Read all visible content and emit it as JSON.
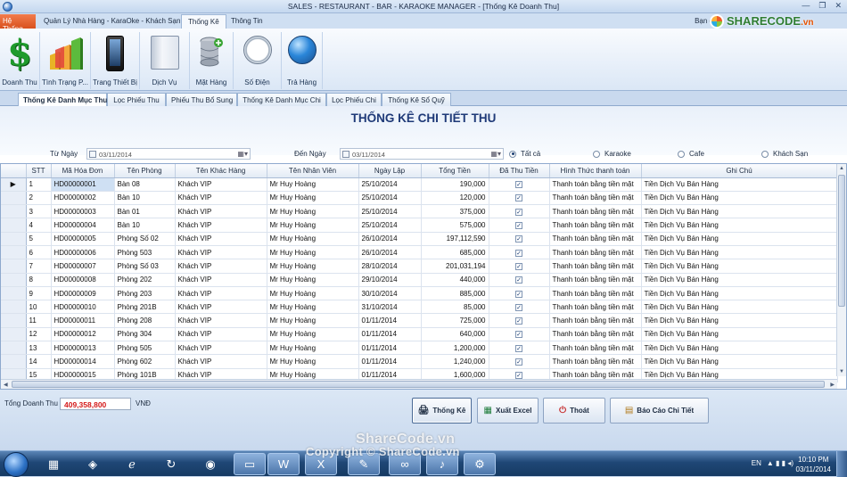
{
  "window": {
    "title": "SALES - RESTAURANT - BAR - KARAOKE MANAGER - [Thống Kê Doanh Thu]"
  },
  "ribbon_tabs": [
    "Hệ Thống",
    "Quản Lý Nhà Hàng - KaraOke - Khách Sạn",
    "Thống Kê",
    "Thông Tin"
  ],
  "user_label": "Bạn đ",
  "logo": {
    "text": "SHARECODE",
    "suffix": ".vn"
  },
  "ribbon_buttons": [
    {
      "label": "Doanh Thu",
      "icon": "dollar-icon"
    },
    {
      "label": "Tình Trạng P...",
      "icon": "bar-chart-icon"
    },
    {
      "label": "Trang Thiết Bị",
      "icon": "phone-icon"
    },
    {
      "label": "Dịch Vụ",
      "icon": "book-icon"
    },
    {
      "label": "Mặt Hàng",
      "icon": "database-add-icon"
    },
    {
      "label": "Số Điện",
      "icon": "clock-icon"
    },
    {
      "label": "Trả Hàng",
      "icon": "globe-icon"
    }
  ],
  "sub_tabs": [
    "Thống Kê Danh Mục Thu",
    "Lọc Phiếu Thu",
    "Phiếu Thu Bổ Sung",
    "Thống Kê Danh Mục Chi",
    "Lọc Phiếu Chi",
    "Thống Kê Sổ Quỹ"
  ],
  "form": {
    "heading": "THỐNG KÊ CHI TIẾT THU",
    "from_label": "Từ Ngày",
    "from_value": "03/11/2014",
    "to_label": "Đến Ngày",
    "to_value": "03/11/2014",
    "radios": [
      {
        "label": "Tất cả",
        "checked": true
      },
      {
        "label": "Karaoke",
        "checked": false
      },
      {
        "label": "Cafe",
        "checked": false
      },
      {
        "label": "Khách Sạn",
        "checked": false
      }
    ]
  },
  "table": {
    "columns": [
      "STT",
      "Mã Hóa Đơn",
      "Tên Phòng",
      "Tên Khác Hàng",
      "Tên Nhân Viên",
      "Ngày Lập",
      "Tổng Tiền",
      "Đã Thu Tiền",
      "Hình Thức thanh toán",
      "Ghi Chú"
    ],
    "rows": [
      [
        "1",
        "HD00000001",
        "Bàn 08",
        "Khách VIP",
        "Mr Huy Hoàng",
        "25/10/2014",
        "190,000",
        true,
        "Thanh toán bằng tiền mặt",
        "Tiền Dịch Vụ Bán Hàng"
      ],
      [
        "2",
        "HD00000002",
        "Bàn 10",
        "Khách VIP",
        "Mr Huy Hoàng",
        "25/10/2014",
        "120,000",
        true,
        "Thanh toán bằng tiền mặt",
        "Tiền Dịch Vụ Bán Hàng"
      ],
      [
        "3",
        "HD00000003",
        "Bàn 01",
        "Khách VIP",
        "Mr Huy Hoàng",
        "25/10/2014",
        "375,000",
        true,
        "Thanh toán bằng tiền mặt",
        "Tiền Dịch Vụ Bán Hàng"
      ],
      [
        "4",
        "HD00000004",
        "Bàn 10",
        "Khách VIP",
        "Mr Huy Hoàng",
        "25/10/2014",
        "575,000",
        true,
        "Thanh toán bằng tiền mặt",
        "Tiền Dịch Vụ Bán Hàng"
      ],
      [
        "5",
        "HD00000005",
        "Phòng Số 02",
        "Khách VIP",
        "Mr Huy Hoàng",
        "26/10/2014",
        "197,112,590",
        true,
        "Thanh toán bằng tiền mặt",
        "Tiền Dịch Vụ Bán Hàng"
      ],
      [
        "6",
        "HD00000006",
        "Phòng 503",
        "Khách VIP",
        "Mr Huy Hoàng",
        "26/10/2014",
        "685,000",
        true,
        "Thanh toán bằng tiền mặt",
        "Tiền Dịch Vụ Bán Hàng"
      ],
      [
        "7",
        "HD00000007",
        "Phòng Số 03",
        "Khách VIP",
        "Mr Huy Hoàng",
        "28/10/2014",
        "201,031,194",
        true,
        "Thanh toán bằng tiền mặt",
        "Tiền Dịch Vụ Bán Hàng"
      ],
      [
        "8",
        "HD00000008",
        "Phòng 202",
        "Khách VIP",
        "Mr Huy Hoàng",
        "29/10/2014",
        "440,000",
        true,
        "Thanh toán bằng tiền mặt",
        "Tiền Dịch Vụ Bán Hàng"
      ],
      [
        "9",
        "HD00000009",
        "Phòng 203",
        "Khách VIP",
        "Mr Huy Hoàng",
        "30/10/2014",
        "885,000",
        true,
        "Thanh toán bằng tiền mặt",
        "Tiền Dịch Vụ Bán Hàng"
      ],
      [
        "10",
        "HD00000010",
        "Phòng 201B",
        "Khách VIP",
        "Mr Huy Hoàng",
        "31/10/2014",
        "85,000",
        true,
        "Thanh toán bằng tiền mặt",
        "Tiền Dịch Vụ Bán Hàng"
      ],
      [
        "11",
        "HD00000011",
        "Phòng 208",
        "Khách VIP",
        "Mr Huy Hoàng",
        "01/11/2014",
        "725,000",
        true,
        "Thanh toán bằng tiền mặt",
        "Tiền Dịch Vụ Bán Hàng"
      ],
      [
        "12",
        "HD00000012",
        "Phòng 304",
        "Khách VIP",
        "Mr Huy Hoàng",
        "01/11/2014",
        "640,000",
        true,
        "Thanh toán bằng tiền mặt",
        "Tiền Dịch Vụ Bán Hàng"
      ],
      [
        "13",
        "HD00000013",
        "Phòng 505",
        "Khách VIP",
        "Mr Huy Hoàng",
        "01/11/2014",
        "1,200,000",
        true,
        "Thanh toán bằng tiền mặt",
        "Tiền Dịch Vụ Bán Hàng"
      ],
      [
        "14",
        "HD00000014",
        "Phòng 602",
        "Khách VIP",
        "Mr Huy Hoàng",
        "01/11/2014",
        "1,240,000",
        true,
        "Thanh toán bằng tiền mặt",
        "Tiền Dịch Vụ Bán Hàng"
      ],
      [
        "15",
        "HD00000015",
        "Phòng 101B",
        "Khách VIP",
        "Mr Huy Hoàng",
        "01/11/2014",
        "1,600,000",
        true,
        "Thanh toán bằng tiền mặt",
        "Tiền Dịch Vụ Bán Hàng"
      ]
    ]
  },
  "footer": {
    "total_label": "Tổng Doanh Thu",
    "total_value": "409,358,800",
    "unit": "VNĐ",
    "buttons": [
      "Thống Kê",
      "Xuất Excel",
      "Thoát",
      "Báo Cáo Chi Tiết"
    ]
  },
  "taskbar": {
    "lang": "EN",
    "time": "10:10 PM",
    "date": "03/11/2014"
  },
  "watermark": {
    "text": "ShareCode.vn",
    "copyright": "Copyright © ShareCode.vn"
  },
  "colors": {
    "accent": "#1f3a78",
    "total": "#d41a1a",
    "system_tab": "#e2622f"
  }
}
